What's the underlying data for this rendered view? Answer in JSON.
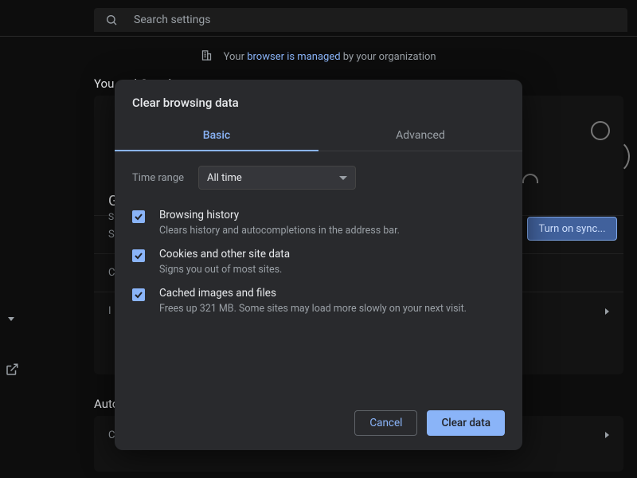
{
  "search": {
    "placeholder": "Search settings"
  },
  "managed": {
    "prefix": "Your ",
    "link": "browser is managed",
    "suffix": " by your organization"
  },
  "background": {
    "you_and_google": "You and Google",
    "autofill_heading": "Auto",
    "sync_button": "Turn on sync...",
    "row1": "G",
    "row1_sub": "S",
    "row2": "S",
    "row3": "C",
    "row4": "I",
    "row5": "C"
  },
  "dialog": {
    "title": "Clear browsing data",
    "tabs": {
      "basic": "Basic",
      "advanced": "Advanced"
    },
    "time_range_label": "Time range",
    "time_range_value": "All time",
    "options": [
      {
        "title": "Browsing history",
        "sub": "Clears history and autocompletions in the address bar."
      },
      {
        "title": "Cookies and other site data",
        "sub": "Signs you out of most sites."
      },
      {
        "title": "Cached images and files",
        "sub": "Frees up 321 MB. Some sites may load more slowly on your next visit."
      }
    ],
    "cancel": "Cancel",
    "confirm": "Clear data"
  }
}
